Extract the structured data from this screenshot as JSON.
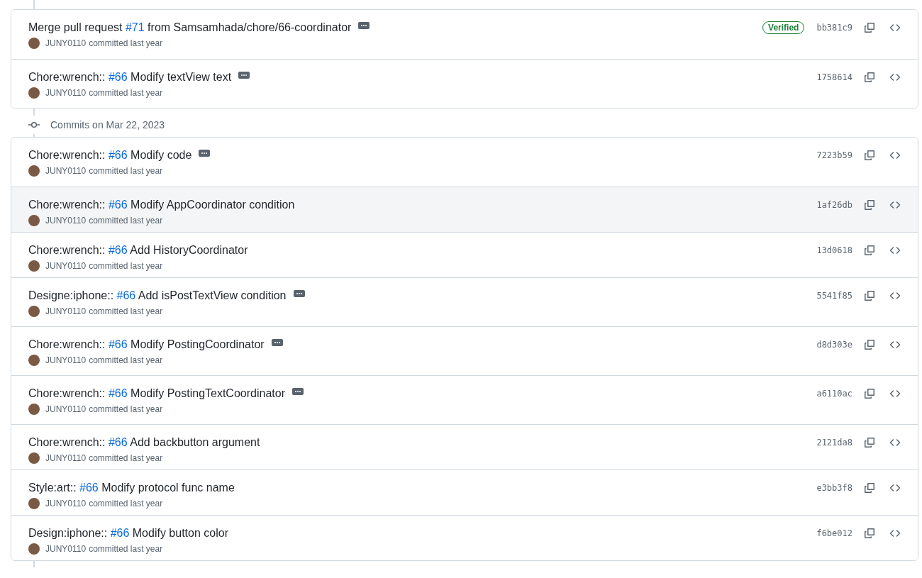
{
  "groups": [
    {
      "commits": [
        {
          "title_before": "Merge pull request ",
          "pr": "#71",
          "title_after": " from Samsamhada/chore/66-coordinator",
          "has_more": true,
          "author": "JUNY0110",
          "meta": "committed last year",
          "badge": "Verified",
          "sha": "bb381c9",
          "highlighted": false
        },
        {
          "title_before": "Chore:wrench:: ",
          "pr": "#66",
          "title_after": " Modify textView text",
          "has_more": true,
          "author": "JUNY0110",
          "meta": "committed last year",
          "sha": "1758614",
          "highlighted": false
        }
      ]
    },
    {
      "heading": "Commits on Mar 22, 2023",
      "commits": [
        {
          "title_before": "Chore:wrench:: ",
          "pr": "#66",
          "title_after": " Modify code",
          "has_more": true,
          "author": "JUNY0110",
          "meta": "committed last year",
          "sha": "7223b59",
          "highlighted": false
        },
        {
          "title_before": "Chore:wrench:: ",
          "pr": "#66",
          "title_after": " Modify AppCoordinator condition",
          "has_more": false,
          "author": "JUNY0110",
          "meta": "committed last year",
          "sha": "1af26db",
          "highlighted": true
        },
        {
          "title_before": "Chore:wrench:: ",
          "pr": "#66",
          "title_after": " Add HistoryCoordinator",
          "has_more": false,
          "author": "JUNY0110",
          "meta": "committed last year",
          "sha": "13d0618",
          "highlighted": false
        },
        {
          "title_before": "Designe:iphone:: ",
          "pr": "#66",
          "title_after": " Add isPostTextView condition",
          "has_more": true,
          "author": "JUNY0110",
          "meta": "committed last year",
          "sha": "5541f85",
          "highlighted": false
        },
        {
          "title_before": "Chore:wrench:: ",
          "pr": "#66",
          "title_after": " Modify PostingCoordinator",
          "has_more": true,
          "author": "JUNY0110",
          "meta": "committed last year",
          "sha": "d8d303e",
          "highlighted": false
        },
        {
          "title_before": "Chore:wrench:: ",
          "pr": "#66",
          "title_after": " Modify PostingTextCoordinator",
          "has_more": true,
          "author": "JUNY0110",
          "meta": "committed last year",
          "sha": "a6110ac",
          "highlighted": false
        },
        {
          "title_before": "Chore:wrench:: ",
          "pr": "#66",
          "title_after": " Add backbutton argument",
          "has_more": false,
          "author": "JUNY0110",
          "meta": "committed last year",
          "sha": "2121da8",
          "highlighted": false
        },
        {
          "title_before": "Style:art:: ",
          "pr": "#66",
          "title_after": " Modify protocol func name",
          "has_more": false,
          "author": "JUNY0110",
          "meta": "committed last year",
          "sha": "e3bb3f8",
          "highlighted": false
        },
        {
          "title_before": "Design:iphone:: ",
          "pr": "#66",
          "title_after": " Modify button color",
          "has_more": false,
          "author": "JUNY0110",
          "meta": "committed last year",
          "sha": "f6be012",
          "highlighted": false
        }
      ]
    }
  ]
}
